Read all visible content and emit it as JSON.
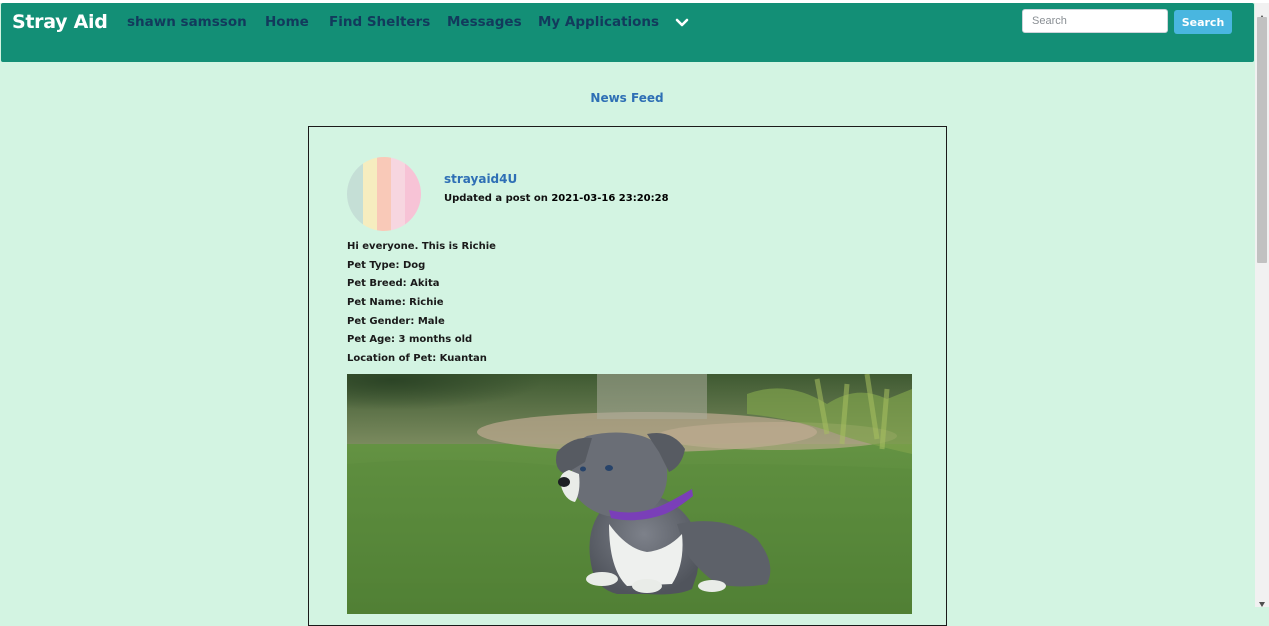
{
  "navbar": {
    "brand": "Stray Aid",
    "links": [
      {
        "label": "shawn samsson"
      },
      {
        "label": "Home"
      },
      {
        "label": "Find Shelters"
      },
      {
        "label": "Messages"
      },
      {
        "label": "My Applications"
      }
    ],
    "dropdown_icon": "chevron-down-icon",
    "search_placeholder": "Search",
    "search_value": "",
    "search_button": "Search"
  },
  "feed": {
    "heading": "News Feed",
    "post": {
      "username": "strayaid4U",
      "meta_prefix": "Updated a post on",
      "timestamp": "2021-03-16 23:20:28",
      "lines": [
        "Hi everyone. This is Richie",
        "Pet Type: Dog",
        "Pet Breed: Akita",
        "Pet Name: Richie",
        "Pet Gender: Male",
        "Pet Age: 3 months old",
        "Location of Pet: Kuantan"
      ],
      "photo_subject": "grey puppy with purple collar sitting on grass"
    }
  },
  "colors": {
    "page_bg": "#d3f4e2",
    "navbar_bg": "#138f76",
    "nav_text": "#123a5c",
    "accent_blue": "#2e6fb5",
    "search_button_bg": "#49b6e0"
  }
}
